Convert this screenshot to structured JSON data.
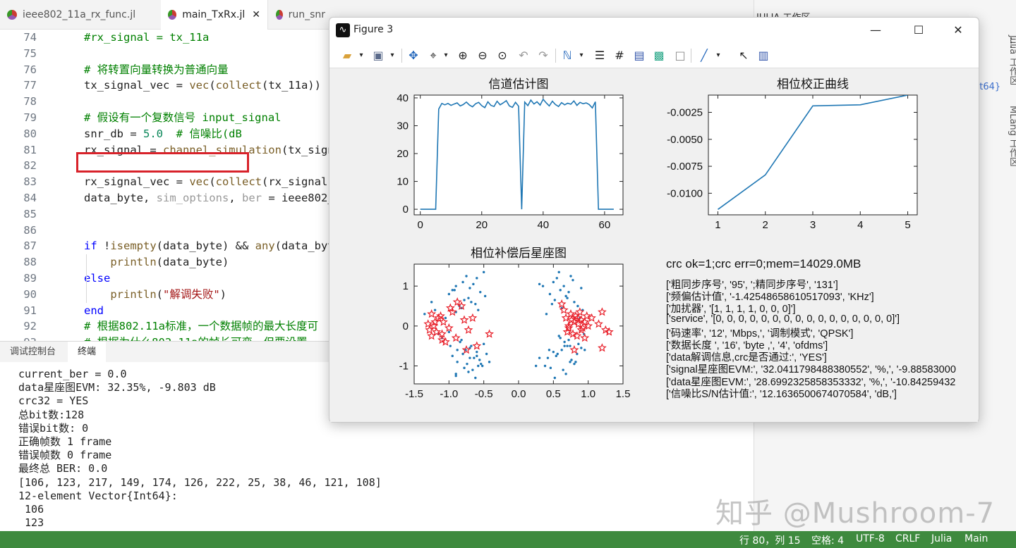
{
  "tabs": [
    {
      "label": "ieee802_11a_rx_func.jl"
    },
    {
      "label": "main_TxRx.jl"
    },
    {
      "label": "run_snr"
    }
  ],
  "editor_lines": [
    {
      "n": "74",
      "tokens": [
        [
          "c-com",
          "#rx_signal = tx_11a"
        ]
      ]
    },
    {
      "n": "75",
      "tokens": []
    },
    {
      "n": "76",
      "tokens": [
        [
          "c-com",
          "# 将转置向量转换为普通向量"
        ]
      ]
    },
    {
      "n": "77",
      "tokens": [
        [
          "c-txt",
          "tx_signal_vec = "
        ],
        [
          "c-fn",
          "vec"
        ],
        [
          "c-txt",
          "("
        ],
        [
          "c-fn",
          "collect"
        ],
        [
          "c-txt",
          "(tx_11a))"
        ]
      ]
    },
    {
      "n": "78",
      "tokens": []
    },
    {
      "n": "79",
      "tokens": [
        [
          "c-com",
          "# 假设有一个复数信号 input_signal"
        ]
      ]
    },
    {
      "n": "80",
      "tokens": [
        [
          "c-txt",
          "snr_db = "
        ],
        [
          "c-num",
          "5.0"
        ],
        [
          "c-com",
          "  # 信噪比(dB"
        ]
      ]
    },
    {
      "n": "81",
      "tokens": [
        [
          "c-txt",
          "rx_signal = "
        ],
        [
          "c-fn",
          "channel_simulation"
        ],
        [
          "c-txt",
          "(tx_sign"
        ]
      ]
    },
    {
      "n": "82",
      "tokens": []
    },
    {
      "n": "83",
      "tokens": [
        [
          "c-txt",
          "rx_signal_vec = "
        ],
        [
          "c-fn",
          "vec"
        ],
        [
          "c-txt",
          "("
        ],
        [
          "c-fn",
          "collect"
        ],
        [
          "c-txt",
          "(rx_signal)"
        ]
      ]
    },
    {
      "n": "84",
      "tokens": [
        [
          "c-txt",
          "data_byte, "
        ],
        [
          "c-dim",
          "sim_options"
        ],
        [
          "c-txt",
          ", "
        ],
        [
          "c-dim",
          "ber"
        ],
        [
          "c-txt",
          " = ieee802_"
        ]
      ]
    },
    {
      "n": "85",
      "tokens": []
    },
    {
      "n": "86",
      "tokens": []
    },
    {
      "n": "87",
      "tokens": [
        [
          "c-kw",
          "if"
        ],
        [
          "c-txt",
          " !"
        ],
        [
          "c-fn",
          "isempty"
        ],
        [
          "c-txt",
          "(data_byte) && "
        ],
        [
          "c-fn",
          "any"
        ],
        [
          "c-txt",
          "(data_byt"
        ]
      ]
    },
    {
      "n": "88",
      "tokens": [
        [
          "c-txt",
          "    "
        ],
        [
          "c-fn",
          "println"
        ],
        [
          "c-txt",
          "(data_byte)"
        ]
      ]
    },
    {
      "n": "89",
      "tokens": [
        [
          "c-kw",
          "else"
        ]
      ]
    },
    {
      "n": "90",
      "tokens": [
        [
          "c-txt",
          "    "
        ],
        [
          "c-fn",
          "println"
        ],
        [
          "c-txt",
          "("
        ],
        [
          "c-str",
          "\"解调失败\""
        ],
        [
          "c-txt",
          ")"
        ]
      ]
    },
    {
      "n": "91",
      "tokens": [
        [
          "c-kw",
          "end"
        ]
      ]
    },
    {
      "n": "92",
      "tokens": [
        [
          "c-com",
          "# 根据802.11a标准，一个数据帧的最大长度可"
        ]
      ]
    },
    {
      "n": "93",
      "tokens": [
        [
          "c-com",
          "# 根据为什么802.11a的帧长可变，但要设置"
        ]
      ]
    }
  ],
  "panel_tabs": {
    "debug": "调试控制台",
    "terminal": "终端"
  },
  "terminal_lines": [
    "current_ber = 0.0",
    "data星座图EVM: 32.35%, -9.803 dB",
    "crc32 = YES",
    "总bit数:128",
    "错误bit数: 0",
    "正确帧数 1 frame",
    "错误帧数 0 frame",
    "最终总 BER: 0.0",
    "[106, 123, 217, 149, 174, 126, 222, 25, 38, 46, 121, 108]",
    "12-element Vector{Int64}:",
    " 106",
    " 123"
  ],
  "right_panel": {
    "title": "JULIA 工作区",
    "frag": "nt64}",
    "v1": "Julia 工作区",
    "v2": "MLang 工作区"
  },
  "statusbar": {
    "pos": "行 80，列 15",
    "spaces": "空格: 4",
    "enc": "UTF-8",
    "eol": "CRLF",
    "lang": "Julia",
    "branch": "Main"
  },
  "watermark": "知乎 @Mushroom-7",
  "figure": {
    "title": "Figure 3",
    "toolbar_icons": [
      "folder-open-icon",
      "save-icon",
      "pan-icon",
      "data-cursor-icon",
      "zoom-in-icon",
      "zoom-out-icon",
      "zoom-fit-icon",
      "undo-icon",
      "redo-icon",
      "brush-icon",
      "list-icon",
      "grid-icon",
      "legend-icon",
      "colorbar-icon",
      "box-icon",
      "line-icon",
      "pointer-icon",
      "table-icon"
    ],
    "crc_text": "crc ok=1;crc err=0;mem=14029.0MB",
    "info_lines": [
      "['粗同步序号', '95', ';精同步序号', '131']",
      "['频偏估计值', '-1.42548658610517093', 'KHz']",
      "['加扰器', '[1, 1, 1, 1, 0, 0, 0]']",
      "['service', '[0, 0, 0, 0, 0, 0, 0, 0, 0, 0, 0, 0, 0, 0, 0, 0]']",
      "['码速率', '12', 'Mbps,', '调制模式', 'QPSK']",
      "['数据长度 ', '16', 'byte ,', '4', 'ofdms']",
      "['data解调信息,crc是否通过:', 'YES']",
      "['signal星座图EVM:', '32.0411798488380552', '%,', '-9.88583000",
      "['data星座图EVM:', '28.6992325858353332', '%,', '-10.84259432",
      "['信噪比S/N估计值:', '12.1636500674070584', 'dB,']"
    ]
  },
  "colors": {
    "line": "#1f77b4",
    "star": "#e8202a",
    "accent": "#3e8a3e"
  },
  "chart_data": [
    {
      "type": "line",
      "title": "信道估计图",
      "xlim": [
        -2,
        66
      ],
      "ylim": [
        -2,
        41
      ],
      "xticks": [
        0,
        20,
        40,
        60
      ],
      "yticks": [
        0,
        10,
        20,
        30,
        40
      ],
      "x": [
        0,
        1,
        2,
        3,
        4,
        5,
        6,
        7,
        8,
        9,
        10,
        11,
        12,
        13,
        14,
        15,
        16,
        17,
        18,
        19,
        20,
        21,
        22,
        23,
        24,
        25,
        26,
        27,
        28,
        29,
        30,
        31,
        32,
        33,
        34,
        35,
        36,
        37,
        38,
        39,
        40,
        41,
        42,
        43,
        44,
        45,
        46,
        47,
        48,
        49,
        50,
        51,
        52,
        53,
        54,
        55,
        56,
        57,
        58,
        59,
        60,
        61,
        62,
        63
      ],
      "y": [
        0,
        0,
        0,
        0,
        0,
        0,
        36,
        38,
        37.5,
        38,
        37.3,
        37.8,
        38.2,
        37.1,
        37.6,
        38.5,
        37.4,
        36.8,
        37.9,
        38.4,
        37.2,
        36.5,
        38.6,
        37.3,
        36.9,
        38.8,
        37.5,
        38.2,
        39,
        37.1,
        36.6,
        38.4,
        37,
        0,
        38.5,
        37.2,
        39.2,
        37.8,
        38.6,
        37.4,
        39.5,
        38.2,
        37.1,
        38.8,
        37.6,
        36.9,
        38.3,
        37.5,
        38.1,
        37.7,
        38.9,
        37.3,
        38.4,
        37.9,
        38.2,
        37.6,
        36.4,
        38.6,
        0,
        0,
        0,
        0,
        0,
        0
      ]
    },
    {
      "type": "line",
      "title": "相位校正曲线",
      "xlim": [
        0.8,
        5.2
      ],
      "ylim": [
        -0.012,
        -0.0009
      ],
      "xticks": [
        1,
        2,
        3,
        4,
        5
      ],
      "yticks": [
        -0.0025,
        -0.005,
        -0.0075,
        -0.01
      ],
      "ytick_labels": [
        "-0.0025",
        "-0.0050",
        "-0.0075",
        "-0.0100"
      ],
      "x": [
        1,
        2,
        3,
        4,
        5
      ],
      "y": [
        -0.0115,
        -0.0083,
        -0.0019,
        -0.0018,
        -0.0009
      ]
    },
    {
      "type": "scatter",
      "title": "相位补偿后星座图",
      "xlim": [
        -1.5,
        1.5
      ],
      "ylim": [
        -1.45,
        1.55
      ],
      "xticks": [
        -1.5,
        -1,
        -0.5,
        0,
        0.5,
        1,
        1.5
      ],
      "xtick_labels": [
        "-1.5",
        "-1.0",
        "-0.5",
        "0.0",
        "0.5",
        "1.0",
        "1.5"
      ],
      "yticks": [
        1,
        0,
        -1
      ],
      "series": [
        {
          "marker": "dot",
          "x": [
            -1.35,
            -1.2,
            -1.25,
            -1.0,
            -0.9,
            -0.95,
            -0.8,
            -0.72,
            -0.85,
            -0.6,
            -0.55,
            -0.7,
            -0.65,
            -0.9,
            -1.05,
            -0.78,
            -0.62,
            -0.5,
            -0.48,
            -0.82,
            -0.92,
            -0.75,
            -0.68,
            -0.58,
            -1.1,
            -0.88,
            -0.7,
            -0.42,
            -0.52,
            -0.98,
            -0.8,
            -0.6,
            -0.66,
            -0.74,
            -0.56,
            -0.9,
            -0.84,
            -1.15,
            -0.95,
            -0.7,
            -0.62,
            -0.78,
            -0.5,
            -0.46,
            -0.88,
            -0.76,
            -0.64,
            -0.58,
            -0.72,
            -0.82,
            -0.68,
            -0.54,
            -0.6,
            -0.9,
            -1.0,
            0.35,
            0.5,
            0.45,
            0.6,
            0.7,
            0.55,
            0.65,
            0.8,
            0.75,
            0.9,
            0.85,
            0.62,
            0.52,
            0.4,
            0.3,
            0.72,
            0.58,
            0.68,
            0.92,
            0.78,
            0.48,
            0.88,
            0.66,
            0.74,
            0.56,
            0.82,
            0.95,
            0.42,
            0.38,
            0.6,
            0.7,
            0.5,
            0.64,
            0.76,
            0.86,
            0.54,
            0.68,
            0.8,
            0.9,
            0.72,
            0.62,
            0.46,
            0.58,
            0.84,
            0.74,
            0.66,
            0.52,
            0.3,
            0.25,
            0.94,
            0.44
          ],
          "y": [
            0.3,
            0.4,
            0.6,
            0.8,
            1.0,
            0.9,
            1.1,
            0.7,
            0.5,
            1.2,
            0.85,
            0.95,
            1.05,
            0.35,
            0.2,
            0.65,
            0.55,
            1.35,
            0.75,
            0.45,
            0.9,
            1.25,
            0.6,
            0.4,
            -0.3,
            -0.6,
            -0.8,
            -0.9,
            -1.0,
            -0.5,
            -0.7,
            -0.65,
            -1.1,
            -0.95,
            -0.85,
            -1.2,
            -0.4,
            -0.2,
            -0.75,
            -0.55,
            -1.3,
            -1.05,
            -0.45,
            -0.7,
            -0.9,
            -0.6,
            -0.8,
            -1.0,
            -1.15,
            -0.35,
            -0.5,
            -0.95,
            -0.75,
            -1.25,
            -0.15,
            1.0,
            1.1,
            0.8,
            0.9,
            0.7,
            1.2,
            1.0,
            0.6,
            1.25,
            0.95,
            0.5,
            0.45,
            0.65,
            0.3,
            1.05,
            0.85,
            1.35,
            0.75,
            0.4,
            1.15,
            0.55,
            0.2,
            -0.4,
            -0.5,
            -0.7,
            -0.9,
            -0.6,
            -0.8,
            -1.0,
            -0.3,
            -0.5,
            -0.65,
            -1.1,
            -0.85,
            -0.45,
            -0.75,
            -1.2,
            -0.95,
            -0.55,
            -0.35,
            -0.6,
            -1.05,
            -0.25,
            -0.7,
            -0.9,
            -0.5,
            -1.3,
            -0.8,
            -1.0,
            -0.2,
            -0.6
          ]
        },
        {
          "marker": "star",
          "x": [
            -1.25,
            -1.2,
            -1.28,
            -1.15,
            -1.1,
            -1.22,
            -1.08,
            -1.0,
            -1.12,
            -1.18,
            -0.95,
            -0.82,
            -0.9,
            -0.78,
            -1.05,
            -0.66,
            -0.72,
            -1.3,
            -0.88,
            -0.98,
            -0.42,
            -1.25,
            -1.1,
            -0.75,
            -0.6,
            0.65,
            0.75,
            0.8,
            0.72,
            0.85,
            0.9,
            0.78,
            0.95,
            0.82,
            1.0,
            0.7,
            0.88,
            0.92,
            0.76,
            0.84,
            1.05,
            1.2,
            1.25,
            1.3,
            1.15,
            1.2,
            0.95,
            0.8,
            0.62,
            0.68,
            0.9,
            0.72,
            0.86,
            0.98
          ],
          "y": [
            0.3,
            0.1,
            -0.1,
            0.2,
            -0.2,
            0.0,
            0.1,
            -0.05,
            0.25,
            -0.15,
            0.35,
            0.5,
            -0.3,
            0.15,
            -0.4,
            0.2,
            -0.1,
            0.05,
            0.6,
            0.45,
            -0.2,
            -0.25,
            -0.35,
            -0.6,
            -0.5,
            0.4,
            0.3,
            0.1,
            0.0,
            0.2,
            -0.1,
            -0.2,
            0.1,
            0.25,
            0.0,
            -0.15,
            0.35,
            -0.05,
            0.15,
            -0.25,
            0.2,
            0.35,
            -0.1,
            -0.15,
            0.05,
            -0.55,
            -0.3,
            -0.6,
            0.55,
            0.2,
            0.15,
            -0.05,
            0.05,
            0.25
          ]
        }
      ]
    }
  ]
}
